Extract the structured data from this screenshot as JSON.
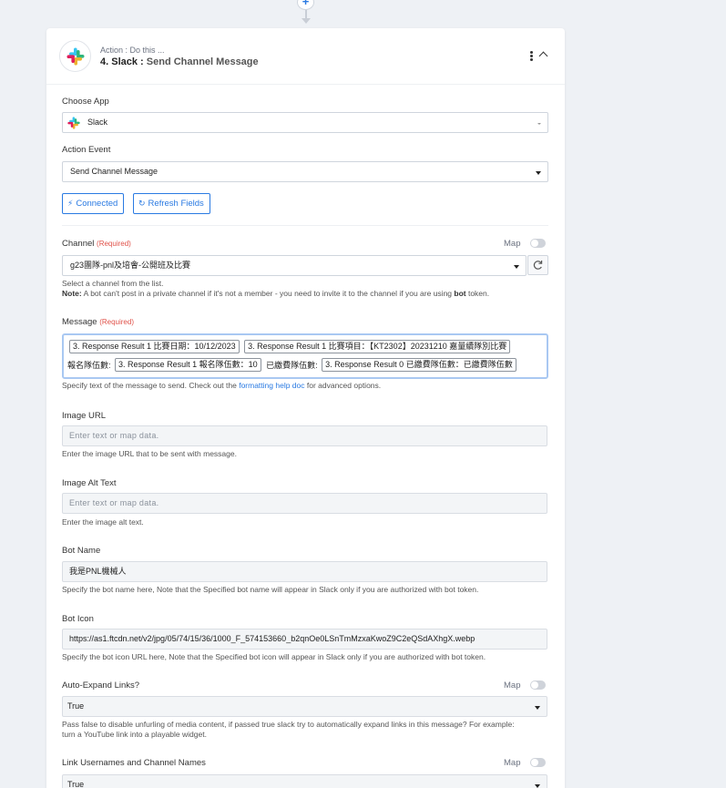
{
  "header": {
    "subtitle": "Action : Do this ...",
    "step": "4. Slack :",
    "action": "Send Channel Message"
  },
  "choose_app": {
    "label": "Choose App",
    "value": "Slack"
  },
  "action_event": {
    "label": "Action Event",
    "value": "Send Channel Message"
  },
  "buttons": {
    "connected": "Connected",
    "refresh": "Refresh Fields"
  },
  "map_label": "Map",
  "required_label": "(Required)",
  "channel": {
    "label": "Channel",
    "value": "g23團隊-pnl及培會-公開班及比賽",
    "help1": "Select a channel from the list.",
    "help2_bold": "Note:",
    "help2_a": " A bot can't post in a private channel if it's not a member - you need to invite it to the channel if you are using ",
    "help2_b": "bot",
    "help2_c": " token."
  },
  "message": {
    "label": "Message",
    "row1": [
      {
        "type": "pill",
        "text": "3. Response Result 1 比賽日期：10/12/2023"
      },
      {
        "type": "pill",
        "text": "3. Response Result 1 比賽項目：【KT2302】20231210 嘉量續隊別比賽"
      }
    ],
    "row2": [
      {
        "type": "plain",
        "text": "報名隊伍數:"
      },
      {
        "type": "pill",
        "text": "3. Response Result 1 報名隊伍數：10"
      },
      {
        "type": "plain",
        "text": "已繳費隊伍數:"
      },
      {
        "type": "pill",
        "text": "3. Response Result 0 已繳費隊伍數：已繳費隊伍數"
      }
    ],
    "help_a": "Specify text of the message to send. Check out the ",
    "help_link": "formatting help doc",
    "help_b": " for advanced options."
  },
  "image_url": {
    "label": "Image URL",
    "placeholder": "Enter text or map data.",
    "help": "Enter the image URL that to be sent with message."
  },
  "image_alt": {
    "label": "Image Alt Text",
    "placeholder": "Enter text or map data.",
    "help": "Enter the image alt text."
  },
  "bot_name": {
    "label": "Bot Name",
    "value": "我是PNL機械人",
    "help": "Specify the bot name here, Note that the Specified bot name will appear in Slack only if you are authorized with bot token."
  },
  "bot_icon": {
    "label": "Bot Icon",
    "value": "https://as1.ftcdn.net/v2/jpg/05/74/15/36/1000_F_574153660_b2qnOe0LSnTmMzxaKwoZ9C2eQSdAXhgX.webp",
    "help": "Specify the bot icon URL here, Note that the Specified bot icon will appear in Slack only if you are authorized with bot token."
  },
  "auto_expand": {
    "label": "Auto-Expand Links?",
    "value": "True",
    "help1": "Pass false to disable unfurling of media content, if passed true slack try to automatically expand links in this message? For example:",
    "help2": "turn a YouTube link into a playable widget."
  },
  "link_usernames": {
    "label": "Link Usernames and Channel Names",
    "value": "True"
  },
  "colors": {
    "accent": "#2a7ae2",
    "required": "#e0524a"
  }
}
